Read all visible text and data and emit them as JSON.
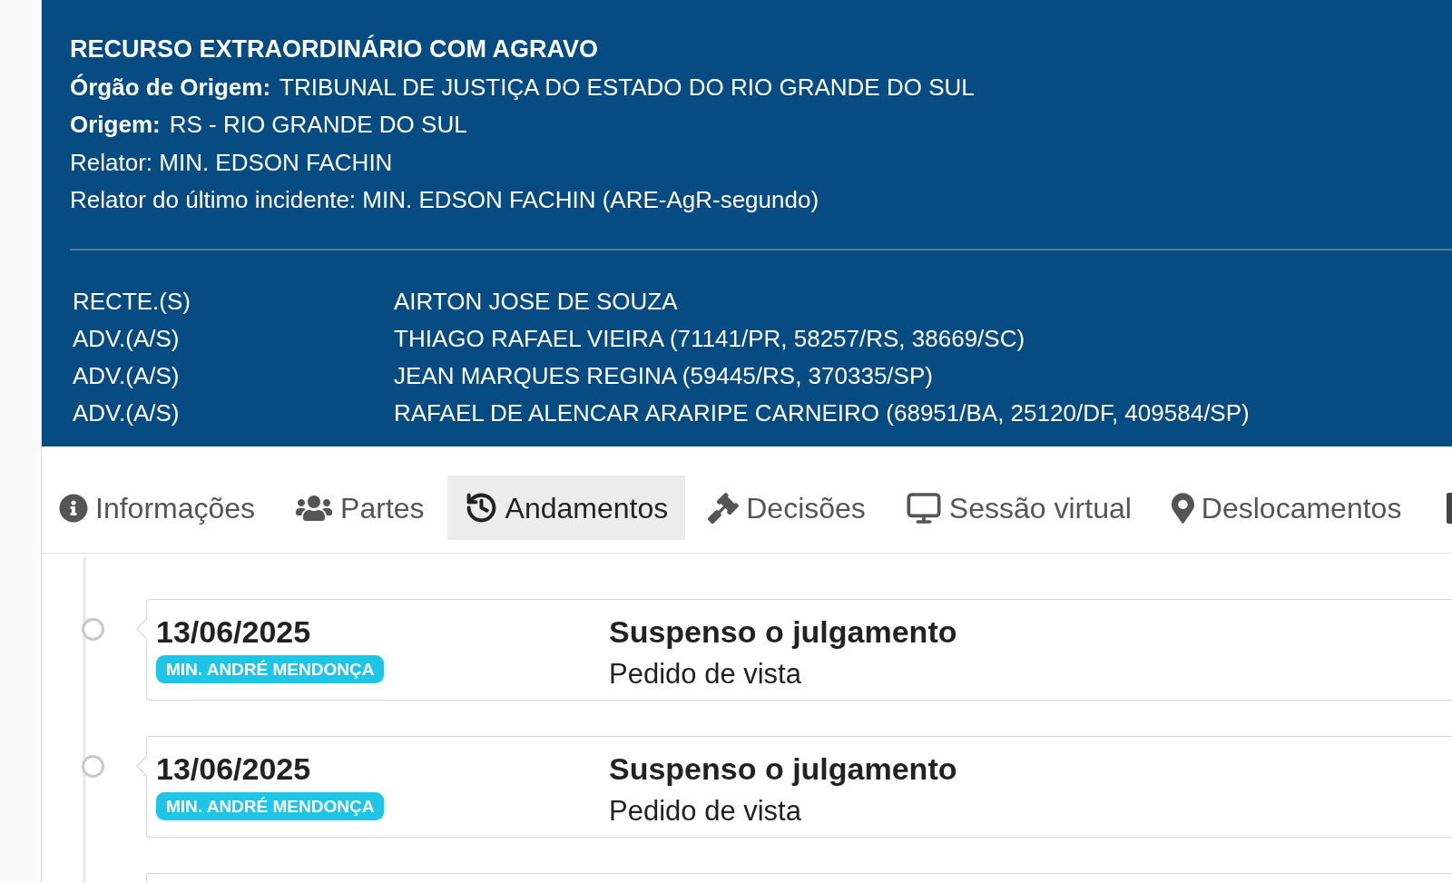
{
  "case_header": {
    "title": "RECURSO EXTRAORDINÁRIO COM AGRAVO",
    "fields": [
      {
        "label": "Órgão de Origem:",
        "value": "TRIBUNAL DE JUSTIÇA DO ESTADO DO RIO GRANDE DO SUL"
      },
      {
        "label": "Origem:",
        "value": "RS - RIO GRANDE DO SUL"
      }
    ],
    "lines": [
      "Relator: MIN. EDSON FACHIN",
      "Relator do último incidente: MIN. EDSON FACHIN (ARE-AgR-segundo)"
    ]
  },
  "parties": [
    {
      "role": "RECTE.(S)",
      "name": "AIRTON JOSE DE SOUZA"
    },
    {
      "role": "ADV.(A/S)",
      "name": "THIAGO RAFAEL VIEIRA (71141/PR, 58257/RS, 38669/SC)"
    },
    {
      "role": "ADV.(A/S)",
      "name": "JEAN MARQUES REGINA (59445/RS, 370335/SP)"
    },
    {
      "role": "ADV.(A/S)",
      "name": "RAFAEL DE ALENCAR ARARIPE CARNEIRO (68951/BA, 25120/DF, 409584/SP)"
    }
  ],
  "tabs": [
    {
      "label": "Informações",
      "selected": false
    },
    {
      "label": "Partes",
      "selected": false
    },
    {
      "label": "Andamentos",
      "selected": true
    },
    {
      "label": "Decisões",
      "selected": false
    },
    {
      "label": "Sessão virtual",
      "selected": false
    },
    {
      "label": "Deslocamentos",
      "selected": false
    }
  ],
  "timeline": [
    {
      "date": "13/06/2025",
      "minister": "MIN. ANDRÉ MENDONÇA",
      "title": "Suspenso o julgamento",
      "detail": "Pedido de vista"
    },
    {
      "date": "13/06/2025",
      "minister": "MIN. ANDRÉ MENDONÇA",
      "title": "Suspenso o julgamento",
      "detail": "Pedido de vista"
    }
  ]
}
